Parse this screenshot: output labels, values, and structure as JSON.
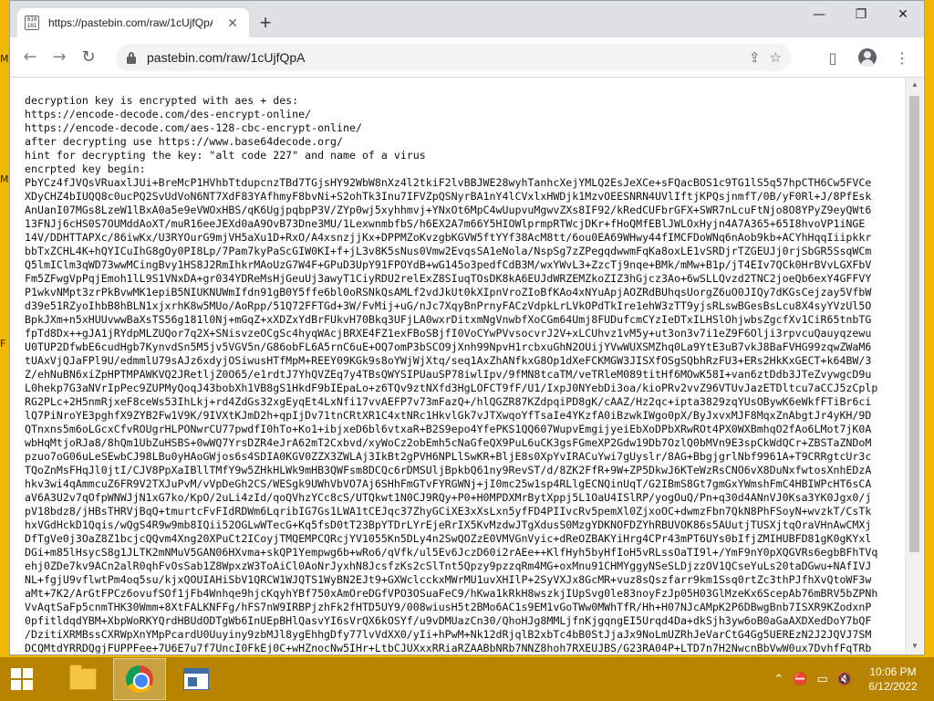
{
  "desktop": {
    "edge_labels": [
      "M",
      "M",
      "F"
    ]
  },
  "browser": {
    "tab": {
      "title": "https://pastebin.com/raw/1cUjfQpA",
      "favicon_text": "010 101"
    },
    "url_display": "pastebin.com/raw/1cUjfQpA",
    "icons": {
      "back": "arrow-left-icon",
      "forward": "arrow-right-icon",
      "reload": "reload-icon",
      "lock": "lock-icon",
      "share": "share-icon",
      "bookmark": "star-icon",
      "sidepanel": "side-panel-icon",
      "profile": "profile-icon",
      "menu": "kebab-menu-icon"
    }
  },
  "content": {
    "lines": [
      "decryption key is encrypted with aes + des:",
      "https://encode-decode.com/des-encrypt-online/",
      "https://encode-decode.com/aes-128-cbc-encrypt-online/",
      "after decrypting use https://www.base64decode.org/",
      "hint for decrypting the key: \"alt code 227\" and name of a virus",
      "encrpted key begin:",
      "PbYCz4fJVQsVRuaxlJUi+BreMcP1HVhbTtdupcnzTBd7TGjsHY92WbW8nXz4l2tkiF2lvBBJWE28wyhTanhcXejYMLQ2EsJeXCe+sFQacBOS1c9TG1lS5q57hpCTH6Cw5FVCe",
      "XDyCHZ4bIUQQ8c0ucPQ2SvUdVoN6NT7XdF83YAfhmyF8bvNi+S2ohTk3Inu7IFVZpQSNyrBA1nY4lCVxlxHWDjk1MzvOEESNRN4UVlIftjKPQsjnmfT/0B/yF0Rl+J/8PfEsk",
      "AnUanI07MGs8LzeW1lBxA0a5e9eVWOxHBS/qK6UgjpqbpP3V/ZYp0wj5xyhhmvj+YNxOt6MpC4wUupvuMgwvZXs8IF92/kRedCUFbrGFX+SWR7nLcuFtNjo8O8YPyZ9eyQWt6",
      "13FNJj6cHS0S7OUMddAoXT/muR16eeJEXd0aA9OvB73Dne3MU/1LexwnmbfbS/h6EX2A7m66Y5HIOWlprmpRTWcjDKr+fHoQMfEBlJWLOxHyjn4A7A365+65I8hvoVP1iNGE",
      "14V/DDHTTAPXc/86iwKx/U3RYOurG9mjVH5aXu1D+RxO/A4xsnzjjKx+DPPMZoKvzgbKGVW5ftYYf38AcM8tt/6ou0EA69WHwy44fIMCFDoWNq6nAob9kb+ACYhHqqIiipkkr",
      "bbTxZCHL4K+hQYICuIhG8gOy0PI8Lp/7Pam7kyPaScGIW0KI+f+jL3v8K5sNus0Vmw2EvqsSA1eNola/NspSg7zZPegqdwwmFqKa8oxLE1vSRDjrTZGEUJj0rjSbGR5SsqWCm",
      "Q5lmIClm3qWD73wwMCingBvy1HS8J2RmIhkrMAoUzG7W4F+GPuD3UpY91FPOYdB+wG145o3pedfCdB3M/wxYWvL3+ZzcTj9nqe+BMk/mMw+B1p/jT4EIv7QCk0HrBVvLGXFbV",
      "Fm5ZFwgVpPqjEmoh1lL9S1VNxDA+gr034YDReMsHjGeuUj3awyT1CiyRDU2relExZ8SIuqTOsDK8kA6EUJdWRZEMZkoZIZ3hGjcz3Ao+6wSLLQvzd2TNC2joeQb6exY4GFFVY",
      "P1wkvNMpt3zrPkBvwMK1epiB5NIUKNUWmIfdn91gB0Y5ffe6bl0oRSNkQsAMLf2vdJkUt0kXIpnVroZIoBfKAo4xNYuApjAOZRdBUhqsUorgZ6uO0JIQy7dKGsCejzay5VfbW",
      "d39e51RZyoIhbB8hBLN1xjxrhK8w5MUo/AoRpp/51Q72FFTGd+3W/FvMij+uG/nJc7XqyBnPrnyFACzVdpkLrLVkOPdTkIre1ehW3zTT9yjsRLswBGesBsLcu8X4syYVzUl5O",
      "BpkJXm+n5xHUUvwwBaXsTS56g181l0Nj+mGqZ+xXDZxYdBrFUkvH70Bkq3UFjLA0wxrDitxmNgVnwbfXoCGm64Umj8FUDufcmCYzIeDTxILHSlOhjwbsZgcfXv1CiR65tnbTG",
      "fpTd8Dx++gJA1jRYdpMLZUQor7q2X+SNisvzeOCgSc4hyqWAcjBRXE4FZ1exFBoSBjfI0VoCYwPVvsocvrJ2V+xLCUhvz1vM5y+ut3on3v7i1eZ9F6Olji3rpvcuQauyqzewu",
      "U0TUP2DfwbE6cudHgb7KynvdSn5M5jv5VGV5n/G86obFL6A5rnC6uE+OQ7omP3bSCO9jXnh99NpvH1rcbxuGhN2OUijYVwWUXSMZhq0La9YtE3uB7vkJ8BaFVHG99zqwZWaM6",
      "tUAxVjQJaFPl9U/edmmlU79sAJz6xdyjOSiwusHTfMpM+REEY09KGk9s8oYWjWjXtq/seq1AxZhANfkxG8Op1dXeFCKMGW3JISXfOSgSQbhRzFU3+ERs2HkKxGECT+k64BW/3",
      "Z/ehNuBN6xiZpHPTMPAWKVQ2JRetljZ0O65/e1rdtJ7YhQVZEq7y4TBsQWYSIPUauSP78iwlIpv/9fMN8tcaTM/veTRleM089titHf6MOwK58I+van6ztDdb3JTeZvywgcD9u",
      "L0hekp7G3aNVrIpPec9ZUPMyQoqJ43bobXh1VB8gS1HkdF9bIEpaLo+z6TQv9ztNXfd3HgLOFCT9fF/U1/IxpJ0NYebDi3oa/kioPRv2vvZ96VTUvJazETDltcu7aCCJ5zCplp",
      "RG2PLc+2H5nmRjxeF8ceWs53IhLkj+rd4ZdGs32xgEyqEt4LxNfi17vvAEFP7v73mFazQ+/hlQGZR87KZdpqiPD8gK/cAAZ/Hz2qc+ipta3829zqYUsOBywK6eWkfFTiBr6ci",
      "lQ7PiNroYE3pghfX9ZYB2Fw1V9K/9IVXtKJmD2h+qpIjDv71tnCRtXR1C4xtNRc1HkvlGk7vJTXwqoYfTsaIe4YKzfA0iBzwkIWgo0pX/ByJxvxMJF8MqxZnAbgtJr4yKH/9D",
      "QTnxns5m6oLGcxCfvROUgrHLPONwrCU77pwdfI0hTo+Ko1+ibjxeD6bl6vtxaR+B2S9epo4YfePKS1QQ607WupvEmgijyeiEbXoDPbXRwROt4PX0WXBmhqO2fAo6LMot7jK0A",
      "wbHqMtjoRJa8/8hQm1UbZuHSBS+0wWQ7YrsDZR4eJrA62mT2Cxbvd/xyWoCz2obEmh5cNaGfeQX9PuL6uCK3gsFGmeXP2Gdw19Db7OzlQ0bMVn9E3spCkWdQCr+ZBSTaZNDoM",
      "pzuo7oG06uLeSEwbCJ98LBu0yHAoGWjos6s4SDIA0KGV0ZZX3ZWLAj3IkBt2gPVH6NPLlSwKR+BljE8s0XpYvIRACuYwi7gUyslr/8AG+BbgjgrlNbf9961A+T9CRRgtcUr3c",
      "TQoZnMsFHqJl0jtI/CJV8PpXaIBllTMfY9w5ZHkHLWk9mHB3QWFsm8DCQc6rDMSUljBpkbQ61ny9RevST/d/8ZK2FfR+9W+ZP5DkwJ6KTeWzRsCNO6vX8DuNxfwtosXnhEDzA",
      "hkv3wi4qAmmcuZ6FR9V2TXJuPvM/vVpDeGh2CS/WESgk9UWhVbVO7Aj6SHhFmGTvFYRGWNj+jI0mc25w1sp4RLlgECNQinUqT/G2IBmS8Gt7gmGxYWmshFmC4HBIWPcHT6sCA",
      "aV6A3U2v7qOfpWNWJjN1xG7ko/KpO/2uLi4zId/qoQVhzYCc8cS/UTQkwt1N0CJ9RQy+P0+H0MPDXMrBytXppj5L1OaU4ISlRP/yogOuQ/Pn+q30d4ANnVJ0Ksa3YK0Jgx0/j",
      "pV18bdz8/jHBsTHRVjBqQ+tmurtcFvFIdRDWm6LqribIG7Gs1LWA1tCEJqc37ZhyGCiXE3xXsLxn5yfFD4PIIvcRv5pemXl0ZjxoOC+dwmzFbn7QkN8PhFSoyN+wvzkT/CsTk",
      "hxVGdHckD1Qqis/wQgS4R9w9mb8IQii52OGLwWTecG+Kq5fsD0tT23BpYTDrLYrEjeRrIX5KvMzdwJTgXdusS0MzgYDKNOFDZYhRBUVOK86s5AUutjTUSXjtqOraVHnAwCMXj",
      "DfTgVe0j3OaZ8Z1bcjcQQvm4Xng20XPuCt2ICoyjTMQEMPCQRcjYV1055Kn5DLy4n2SwQOZzE0VMVGnVyic+dReOZBAKYiHrg4CPr43mPT6UYs0bIfjZMIHUBFD81gK0gKYxl",
      "DGi+m85lHsycS8g1JLTK2mNMuV5GAN06HXvma+skQP1Yempwg6b+wRo6/qVfk/ul5Ev6JczD60i2rAEe++KlfHyh5byHfIoH5vRLssOaTI9l+/YmF9nY0pXQGVRs6egbBFhTVq",
      "ehj0ZDe7kv9ACn2alR0qhFvOsSab1Z8WpxzW3ToAiCl0AoNrJyxhN8JcsfzKs2cSlTnt5Qpzy9pzzqRm4MG+oxMnu91CHMYggyNSeSLDjzzOV1QCseYuLs20taDGwu+NAfIVJ",
      "NL+fgjU9vflwtPm4oq5su/kjxQOUIAHiSbV1QRCW1WJQTS1WyBN2EJt9+GXWclcckxMWrMU1uvXHIlP+2SyVXJx8GcMR+vuz8sQszfarr9km1Ssq0rtZc3thPJfhXvQtoWF3w",
      "aMt+7K2/ArGtFPCz6ovufSOf1jFb4Wnhqe9hjcKqyhYBf750xAmOreDGfVPO3OSuaFeC9/hKwa1kRkH8wszkjIUpSvg0le83noyFzJp05H03GlMzeKx6ScepAb76mBRV5bZPNh",
      "VvAqtSaFp5cnmTHK30Wmm+8XtFALKNFFg/hFS7nW9IRBPjzhFk2fHTD5UY9/008wiusH5t2BMo6AC1s9EM1vGoTWw0MWhTfR/Hh+H07NJcAMpK2P6DBwgBnb7ISXR9KZodxnP",
      "0pfitldqdYBM+XbpWoRKYQrdHBUdODTgWb6InUEpBHlQasvYI6sVrQX6kOSYf/u9vDMUazCn30/QhoHJg8MMLjfnKjgqngEI5Urqd4Da+dkSjh3yw6oB0aGaAXDXedDoY7bQF",
      "/DzitiXRMBssCXRWpXnYMpPcardU0Uuyiny9zbMJl8ygEhhgDfy77lvVdXX0/yIi+hPwM+Nk12dRjqlB2xbTc4bB0StJjaJx9NoLmUZRhJeVarCtG4Gg5UEREzN2J2JQVJ7SM",
      "DCQMtdYRRDQgjFUPPFee+7U6E7u7f7UncI0FkEj0C+wHZnocNw5IHr+LtbCJUXxxRRiaRZAABbNRb7NNZ8hoh7RXEUJBS/G23RA04P+LTD7n7H2NwcnBbVwW0ux7DvhfFqTRb"
    ]
  },
  "taskbar": {
    "apps": [
      {
        "name": "file-explorer",
        "active": false
      },
      {
        "name": "chrome",
        "active": true
      },
      {
        "name": "app-window",
        "active": false
      }
    ],
    "clock": {
      "time": "10:06 PM",
      "date": "6/12/2022"
    }
  }
}
